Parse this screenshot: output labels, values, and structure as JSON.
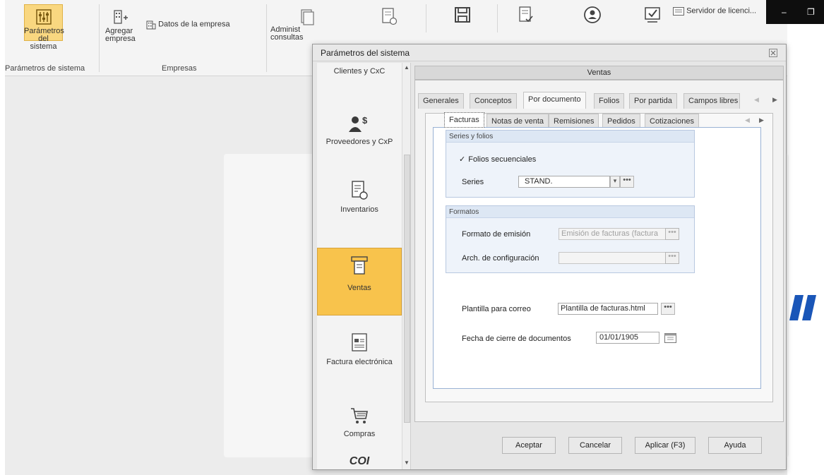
{
  "ribbon": {
    "btn_parametros_line1": "Parámetros",
    "btn_parametros_line2": "del sistema",
    "group_parametros": "Parámetros de sistema",
    "btn_agregar_line1": "Agregar",
    "btn_agregar_line2": "empresa",
    "btn_datos_empresa": "Datos de la empresa",
    "group_empresas": "Empresas",
    "btn_admin_line1": "Administ",
    "btn_admin_line2": "consultas",
    "btn_servidor": "Servidor de licenci..."
  },
  "dialog": {
    "title": "Parámetros del sistema",
    "nav": {
      "items": [
        {
          "label": "Clientes y CxC",
          "icon": "clients-icon"
        },
        {
          "label": "Proveedores y CxP",
          "icon": "suppliers-icon"
        },
        {
          "label": "Inventarios",
          "icon": "inventory-icon"
        },
        {
          "label": "Ventas",
          "icon": "sales-icon"
        },
        {
          "label": "Factura electrónica",
          "icon": "e-invoice-icon"
        },
        {
          "label": "Compras",
          "icon": "cart-icon"
        },
        {
          "label": "COI",
          "icon": "coi-logo"
        }
      ]
    },
    "section_title": "Ventas",
    "tabs": [
      "Generales",
      "Conceptos",
      "Por documento",
      "Folios",
      "Por partida",
      "Campos libres"
    ],
    "doc_tabs": [
      "Facturas",
      "Notas de venta",
      "Remisiones",
      "Pedidos",
      "Cotizaciones"
    ],
    "series_group": {
      "title": "Series y folios",
      "checkbox_label": "Folios secuenciales",
      "checkbox_checked": true,
      "series_label": "Series",
      "series_value": "STAND."
    },
    "formatos_group": {
      "title": "Formatos",
      "formato_label": "Formato de emisión",
      "formato_value": "Emisión de facturas (factura",
      "arch_label": "Arch. de configuración",
      "arch_value": ""
    },
    "plantilla_label": "Plantilla para correo",
    "plantilla_value": "Plantilla de facturas.html",
    "fecha_label": "Fecha de cierre de documentos",
    "fecha_value": "01/01/1905",
    "buttons": {
      "aceptar": "Aceptar",
      "cancelar": "Cancelar",
      "aplicar": "Aplicar (F3)",
      "ayuda": "Ayuda"
    }
  },
  "window_controls": {
    "minimize": "–",
    "restore": "❐"
  }
}
